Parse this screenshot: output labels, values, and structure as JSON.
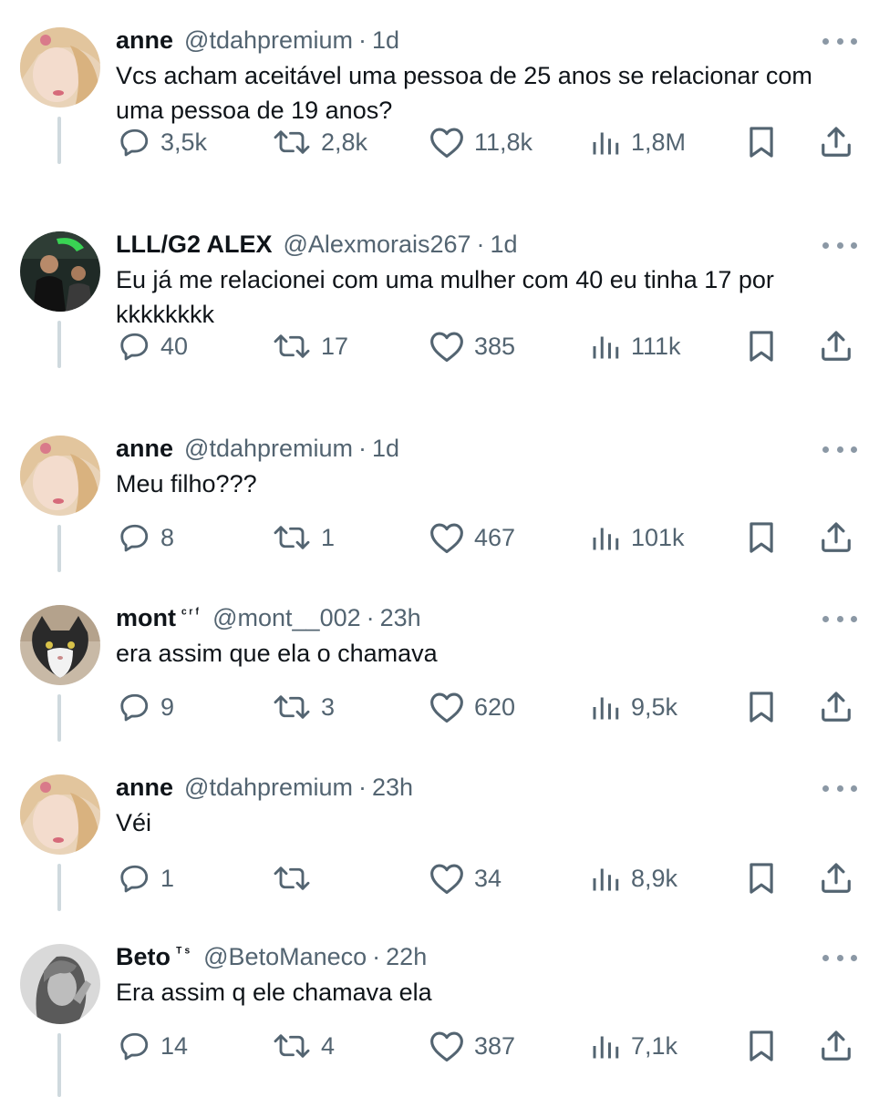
{
  "tweets": [
    {
      "name": "anne",
      "badge": "",
      "handle": "@tdahpremium",
      "time": "1d",
      "text": "Vcs acham aceitável uma pessoa de 25 anos se relacionar com uma pessoa de 19 anos?",
      "replies": "3,5k",
      "reposts": "2,8k",
      "likes": "11,8k",
      "views": "1,8M"
    },
    {
      "name": "LLL/G2 ALEX",
      "badge": "",
      "handle": "@Alexmorais267",
      "time": "1d",
      "text": "Eu já me relacionei com uma mulher com 40 eu tinha 17 por kkkkkkkk",
      "replies": "40",
      "reposts": "17",
      "likes": "385",
      "views": "111k"
    },
    {
      "name": "anne",
      "badge": "",
      "handle": "@tdahpremium",
      "time": "1d",
      "text": "Meu filho???",
      "replies": "8",
      "reposts": "1",
      "likes": "467",
      "views": "101k"
    },
    {
      "name": "mont",
      "badge": "ᶜʳᶠ",
      "handle": "@mont__002",
      "time": "23h",
      "text": "era assim que ela o chamava",
      "replies": "9",
      "reposts": "3",
      "likes": "620",
      "views": "9,5k"
    },
    {
      "name": "anne",
      "badge": "",
      "handle": "@tdahpremium",
      "time": "23h",
      "text": "Véi",
      "replies": "1",
      "reposts": "",
      "likes": "34",
      "views": "8,9k"
    },
    {
      "name": "Beto",
      "badge": "ᵀˢ",
      "handle": "@BetoManeco",
      "time": "22h",
      "text": "Era assim q ele chamava ela",
      "replies": "14",
      "reposts": "4",
      "likes": "387",
      "views": "7,1k"
    }
  ],
  "separator": "·",
  "icons": {
    "reply": "reply-icon",
    "repost": "repost-icon",
    "like": "like-icon",
    "views": "views-icon",
    "bookmark": "bookmark-icon",
    "share": "share-icon",
    "more": "more-icon"
  },
  "colors": {
    "text_primary": "#0f1419",
    "text_secondary": "#536471",
    "thread_line": "#cfd9de"
  }
}
